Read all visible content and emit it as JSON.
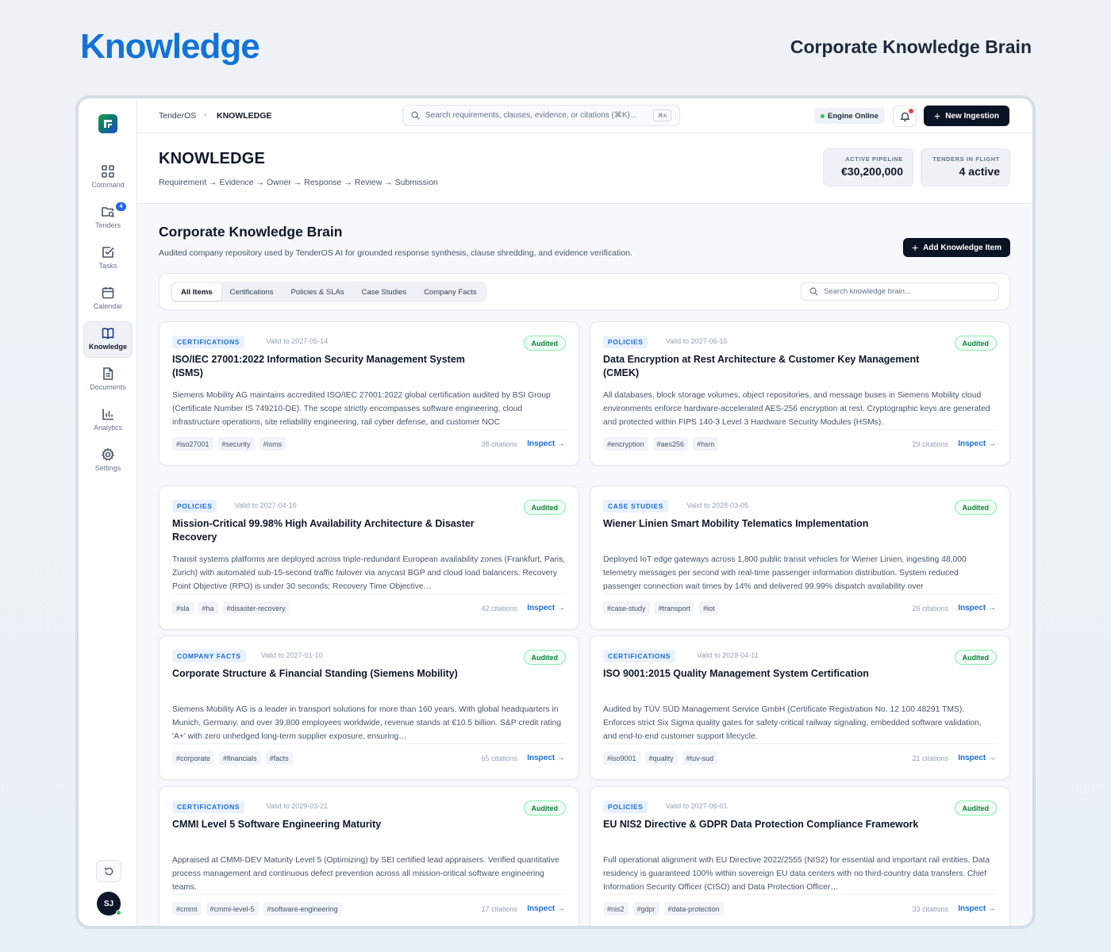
{
  "hero": {
    "title": "Knowledge",
    "subtitle": "Corporate Knowledge Brain"
  },
  "sidebar": {
    "items": [
      {
        "label": "Command",
        "icon": "grid-icon"
      },
      {
        "label": "Tenders",
        "icon": "folder-search-icon",
        "badge": "4"
      },
      {
        "label": "Tasks",
        "icon": "checkbox-icon"
      },
      {
        "label": "Calendar",
        "icon": "calendar-icon"
      },
      {
        "label": "Knowledge",
        "icon": "book-icon",
        "active": true
      },
      {
        "label": "Documents",
        "icon": "document-icon"
      },
      {
        "label": "Analytics",
        "icon": "bar-chart-icon"
      },
      {
        "label": "Settings",
        "icon": "gear-icon"
      }
    ],
    "avatar": "SJ"
  },
  "topbar": {
    "breadcrumb_root": "TenderOS",
    "breadcrumb_current": "KNOWLEDGE",
    "search_placeholder": "Search requirements, clauses, evidence, or citations (⌘K)...",
    "search_shortcut": "⌘K",
    "engine_status": "Engine Online",
    "new_ingestion": "New Ingestion"
  },
  "header": {
    "title": "KNOWLEDGE",
    "flow": "Requirement → Evidence → Owner → Response → Review → Submission",
    "stats": [
      {
        "label": "ACTIVE PIPELINE",
        "value": "€30,200,000"
      },
      {
        "label": "TENDERS IN FLIGHT",
        "value": "4 active"
      }
    ]
  },
  "section": {
    "title": "Corporate Knowledge Brain",
    "description": "Audited company repository used by TenderOS AI for grounded response synthesis, clause shredding, and evidence verification.",
    "add_button": "Add Knowledge Item"
  },
  "filters": {
    "tabs": [
      "All Items",
      "Certifications",
      "Policies & SLAs",
      "Case Studies",
      "Company Facts"
    ],
    "active_tab": "All Items",
    "search_placeholder": "Search knowledge brain..."
  },
  "cards": [
    {
      "category": "CERTIFICATIONS",
      "valid": "Valid to 2027-05-14",
      "status": "Audited",
      "title": "ISO/IEC 27001:2022 Information Security Management System (ISMS)",
      "body": "Siemens Mobility AG maintains accredited ISO/IEC 27001:2022 global certification audited by BSI Group (Certificate Number IS 749210-DE). The scope strictly encompasses software engineering, cloud infrastructure operations, site reliability engineering, rail cyber defense, and customer NOC",
      "tags": [
        "#iso27001",
        "#security",
        "#isms"
      ],
      "citations": "38 citations",
      "action": "Inspect →"
    },
    {
      "category": "POLICIES",
      "valid": "Valid to 2027-06-15",
      "status": "Audited",
      "title": "Data Encryption at Rest Architecture & Customer Key Management (CMEK)",
      "body": "All databases, block storage volumes, object repositories, and message buses in Siemens Mobility cloud environments enforce hardware-accelerated AES-256 encryption at rest. Cryptographic keys are generated and protected within FIPS 140-3 Level 3 Hardware Security Modules (HSMs).",
      "tags": [
        "#encryption",
        "#aes256",
        "#hsm"
      ],
      "citations": "29 citations",
      "action": "Inspect →"
    },
    {
      "category": "POLICIES",
      "valid": "Valid to 2027-04-10",
      "status": "Audited",
      "title": "Mission-Critical 99.98% High Availability Architecture & Disaster Recovery",
      "body": "Transit systems platforms are deployed across triple-redundant European availability zones (Frankfurt, Paris, Zurich) with automated sub-15-second traffic failover via anycast BGP and cloud load balancers. Recovery Point Objective (RPO) is under 30 seconds; Recovery Time Objective…",
      "tags": [
        "#sla",
        "#ha",
        "#disaster-recovery"
      ],
      "citations": "42 citations",
      "action": "Inspect →"
    },
    {
      "category": "CASE STUDIES",
      "valid": "Valid to 2028-03-05",
      "status": "Audited",
      "title": "Wiener Linien Smart Mobility Telematics Implementation",
      "body": "Deployed IoT edge gateways across 1,800 public transit vehicles for Wiener Linien, ingesting 48,000 telemetry messages per second with real-time passenger information distribution. System reduced passenger connection wait times by 14% and delivered 99.99% dispatch availability over",
      "tags": [
        "#case-study",
        "#transport",
        "#iot"
      ],
      "citations": "26 citations",
      "action": "Inspect →"
    },
    {
      "category": "COMPANY FACTS",
      "valid": "Valid to 2027-01-10",
      "status": "Audited",
      "title": "Corporate Structure & Financial Standing (Siemens Mobility)",
      "body": "Siemens Mobility AG is a leader in transport solutions for more than 160 years. With global headquarters in Munich, Germany, and over 39,800 employees worldwide, revenue stands at €10.5 billion. S&P credit rating 'A+' with zero unhedged long-term supplier exposure, ensuring…",
      "tags": [
        "#corporate",
        "#financials",
        "#facts"
      ],
      "citations": "65 citations",
      "action": "Inspect →"
    },
    {
      "category": "CERTIFICATIONS",
      "valid": "Valid to 2028-04-11",
      "status": "Audited",
      "title": "ISO 9001:2015 Quality Management System Certification",
      "body": "Audited by TÜV SÜD Management Service GmbH (Certificate Registration No. 12 100 48291 TMS). Enforces strict Six Sigma quality gates for safety-critical railway signaling, embedded software validation, and end-to-end customer support lifecycle.",
      "tags": [
        "#iso9001",
        "#quality",
        "#tuv-sud"
      ],
      "citations": "21 citations",
      "action": "Inspect →"
    },
    {
      "category": "CERTIFICATIONS",
      "valid": "Valid to 2029-03-21",
      "status": "Audited",
      "title": "CMMI Level 5 Software Engineering Maturity",
      "body": "Appraised at CMMI-DEV Maturity Level 5 (Optimizing) by SEI certified lead appraisers. Verified quantitative process management and continuous defect prevention across all mission-critical software engineering teams.",
      "tags": [
        "#cmmi",
        "#cmmi-level-5",
        "#software-engineering"
      ],
      "citations": "17 citations",
      "action": "Inspect →"
    },
    {
      "category": "POLICIES",
      "valid": "Valid to 2027-06-01",
      "status": "Audited",
      "title": "EU NIS2 Directive & GDPR Data Protection Compliance Framework",
      "body": "Full operational alignment with EU Directive 2022/2555 (NIS2) for essential and important rail entities. Data residency is guaranteed 100% within sovereign EU data centers with no third-country data transfers. Chief Information Security Officer (CISO) and Data Protection Officer…",
      "tags": [
        "#nis2",
        "#gdpr",
        "#data-protection"
      ],
      "citations": "33 citations",
      "action": "Inspect →"
    }
  ],
  "colors": {
    "accent": "#1273d8",
    "brand_dark": "#0b1424",
    "audited_green": "#15803d",
    "category_blue": "#1d6fd6"
  }
}
